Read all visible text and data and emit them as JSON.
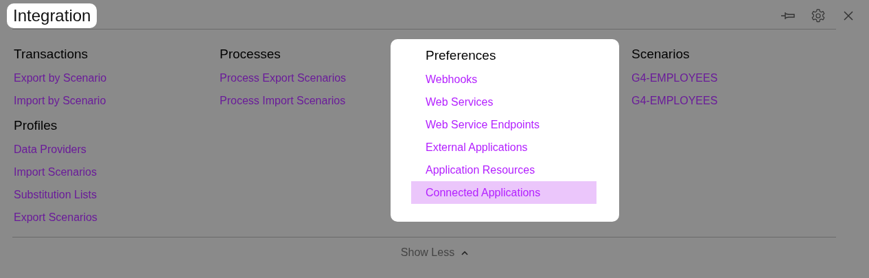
{
  "header": {
    "title": "Integration",
    "highlighted": true
  },
  "columns": [
    {
      "sections": [
        {
          "heading": "Transactions",
          "highlighted": false,
          "links": [
            {
              "label": "Export by Scenario",
              "selected": false
            },
            {
              "label": "Import by Scenario",
              "selected": false
            }
          ]
        },
        {
          "heading": "Profiles",
          "highlighted": false,
          "links": [
            {
              "label": "Data Providers",
              "selected": false
            },
            {
              "label": "Import Scenarios",
              "selected": false
            },
            {
              "label": "Substitution Lists",
              "selected": false
            },
            {
              "label": "Export Scenarios",
              "selected": false
            }
          ]
        }
      ]
    },
    {
      "sections": [
        {
          "heading": "Processes",
          "highlighted": false,
          "links": [
            {
              "label": "Process Export Scenarios",
              "selected": false
            },
            {
              "label": "Process Import Scenarios",
              "selected": false
            }
          ]
        }
      ]
    },
    {
      "sections": [
        {
          "heading": "Preferences",
          "highlighted": true,
          "links": [
            {
              "label": "Webhooks",
              "selected": false
            },
            {
              "label": "Web Services",
              "selected": false
            },
            {
              "label": "Web Service Endpoints",
              "selected": false
            },
            {
              "label": "External Applications",
              "selected": false
            },
            {
              "label": "Application Resources",
              "selected": false
            },
            {
              "label": "Connected Applications",
              "selected": true
            }
          ]
        }
      ]
    },
    {
      "sections": [
        {
          "heading": "Scenarios",
          "highlighted": false,
          "links": [
            {
              "label": "G4-EMPLOYEES",
              "selected": false
            },
            {
              "label": "G4-EMPLOYEES",
              "selected": false
            }
          ]
        }
      ]
    }
  ],
  "footer": {
    "toggle": "Show Less",
    "expanded": true
  }
}
